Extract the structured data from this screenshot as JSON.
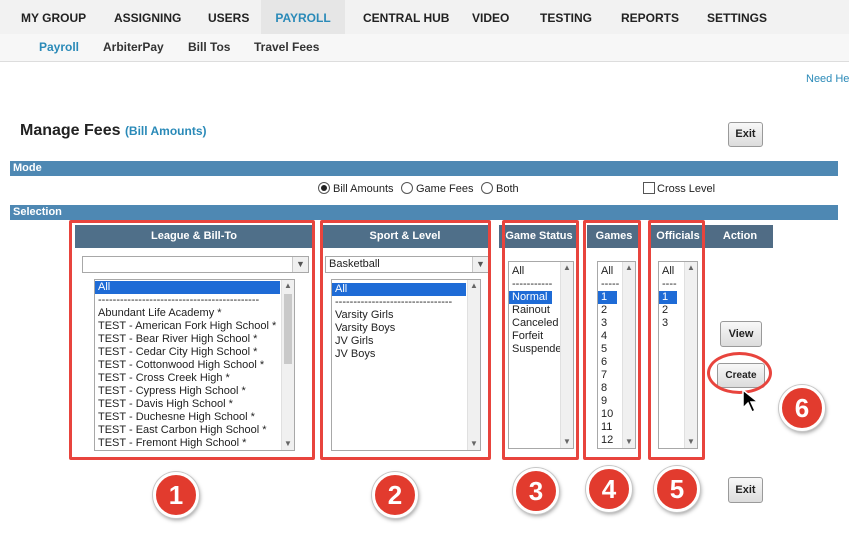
{
  "top_nav": [
    "MY GROUP",
    "ASSIGNING",
    "USERS",
    "PAYROLL",
    "CENTRAL HUB",
    "VIDEO",
    "TESTING",
    "REPORTS",
    "SETTINGS"
  ],
  "sub_nav": [
    "Payroll",
    "ArbiterPay",
    "Bill Tos",
    "Travel Fees"
  ],
  "help_link": "Need Hel",
  "page_title": "Manage Fees",
  "page_subtitle": "(Bill Amounts)",
  "buttons": {
    "exit_top": "Exit",
    "view": "View",
    "create": "Create",
    "exit_bottom": "Exit"
  },
  "mode": {
    "label": "Mode",
    "options": [
      "Bill Amounts",
      "Game Fees",
      "Both"
    ],
    "selected": "Bill Amounts",
    "cross_level": "Cross Level"
  },
  "selection_label": "Selection",
  "columns": [
    "League & Bill-To",
    "Sport & Level",
    "Game Status",
    "Games",
    "Officials",
    "Action"
  ],
  "league": {
    "combo_value": "",
    "items": [
      "All",
      "--------------------------------------------",
      "Abundant Life Academy *",
      "TEST - American Fork High School *",
      "TEST - Bear River High School *",
      "TEST - Cedar City High School *",
      "TEST - Cottonwood High School *",
      "TEST - Cross Creek High *",
      "TEST - Cypress High School *",
      "TEST - Davis High School *",
      "TEST - Duchesne High School *",
      "TEST - East Carbon High School *",
      "TEST - Fremont High School *"
    ]
  },
  "sport": {
    "combo_value": "Basketball",
    "items": [
      "All",
      "--------------------------------",
      "Varsity Girls",
      "Varsity Boys",
      "JV Girls",
      "JV Boys"
    ]
  },
  "game_status": {
    "items": [
      "All",
      "-----------",
      "Normal",
      "Rainout",
      "Canceled",
      "Forfeit",
      "Suspended"
    ]
  },
  "games": {
    "items": [
      "All",
      "-----",
      "1",
      "2",
      "3",
      "4",
      "5",
      "6",
      "7",
      "8",
      "9",
      "10",
      "11",
      "12"
    ]
  },
  "officials": {
    "items": [
      "All",
      "----",
      "1",
      "2",
      "3"
    ]
  },
  "callouts": [
    "1",
    "2",
    "3",
    "4",
    "5",
    "6"
  ]
}
